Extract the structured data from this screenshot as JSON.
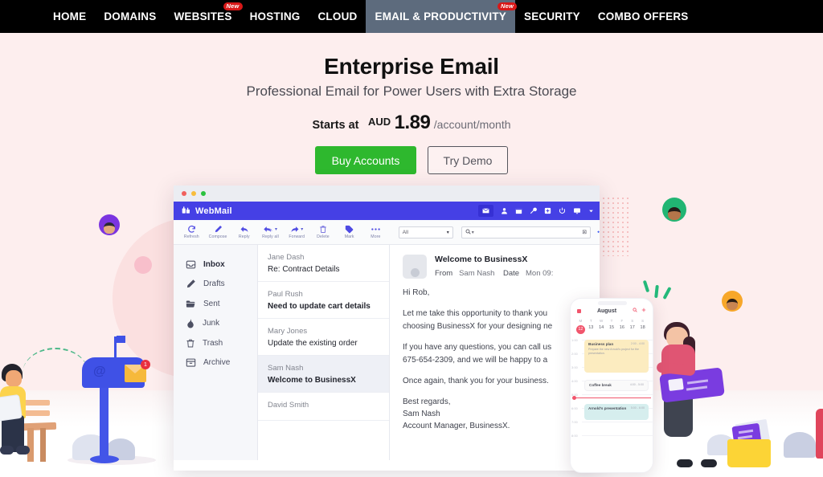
{
  "nav": {
    "items": [
      {
        "label": "HOME",
        "badge": null,
        "active": false
      },
      {
        "label": "DOMAINS",
        "badge": null,
        "active": false
      },
      {
        "label": "WEBSITES",
        "badge": "New",
        "active": false
      },
      {
        "label": "HOSTING",
        "badge": null,
        "active": false
      },
      {
        "label": "CLOUD",
        "badge": null,
        "active": false
      },
      {
        "label": "EMAIL & PRODUCTIVITY",
        "badge": "New",
        "active": true
      },
      {
        "label": "SECURITY",
        "badge": null,
        "active": false
      },
      {
        "label": "COMBO OFFERS",
        "badge": null,
        "active": false
      }
    ]
  },
  "hero": {
    "title": "Enterprise Email",
    "subtitle": "Professional Email for Power Users with Extra Storage",
    "price_prefix": "Starts at",
    "currency": "AUD",
    "amount": "1.89",
    "period": "/account/month",
    "buy_button": "Buy Accounts",
    "demo_button": "Try Demo"
  },
  "colors": {
    "page_bg": "#fdeeee",
    "nav_bg": "#000000",
    "nav_active_bg": "#5d6b7d",
    "badge_red": "#d81818",
    "buy_green": "#2eb82e",
    "webmail_purple": "#4540e5"
  },
  "webmail": {
    "brand": "WebMail",
    "window_dots": [
      "red",
      "yellow",
      "green"
    ],
    "top_icons": [
      "mail-icon",
      "user-icon",
      "calendar-icon",
      "wrench-icon",
      "plus-box-icon",
      "power-icon",
      "monitor-icon",
      "chevron-down-icon"
    ],
    "toolbar": [
      {
        "label": "Refresh",
        "icon": "refresh-icon",
        "caret": false
      },
      {
        "label": "Compose",
        "icon": "pencil-icon",
        "caret": false
      },
      {
        "label": "Reply",
        "icon": "reply-icon",
        "caret": false
      },
      {
        "label": "Reply all",
        "icon": "reply-all-icon",
        "caret": true
      },
      {
        "label": "Forward",
        "icon": "forward-icon",
        "caret": true
      },
      {
        "label": "Delete",
        "icon": "trash-icon",
        "caret": false
      },
      {
        "label": "Mark",
        "icon": "tag-icon",
        "caret": false
      },
      {
        "label": "More",
        "icon": "ellipsis-icon",
        "caret": false
      }
    ],
    "filter_value": "All",
    "search_placeholder": "Q",
    "sidebar": [
      {
        "label": "Inbox",
        "icon": "inbox-icon",
        "active": true
      },
      {
        "label": "Drafts",
        "icon": "pencil-icon",
        "active": false
      },
      {
        "label": "Sent",
        "icon": "folder-icon",
        "active": false
      },
      {
        "label": "Junk",
        "icon": "flame-icon",
        "active": false
      },
      {
        "label": "Trash",
        "icon": "trash-icon",
        "active": false
      },
      {
        "label": "Archive",
        "icon": "archive-icon",
        "active": false
      }
    ],
    "messages": [
      {
        "from": "Jane Dash",
        "subject": "Re: Contract Details",
        "selected": false
      },
      {
        "from": "Paul Rush",
        "subject": "Need to update cart details",
        "selected": false
      },
      {
        "from": "Mary Jones",
        "subject": "Update the existing order",
        "selected": false
      },
      {
        "from": "Sam Nash",
        "subject": "Welcome to BusinessX",
        "selected": true
      },
      {
        "from": "David Smith",
        "subject": "",
        "selected": false
      }
    ],
    "reading": {
      "subject": "Welcome to BusinessX",
      "from_label": "From",
      "from_value": "Sam Nash",
      "date_label": "Date",
      "date_value": "Mon 09:",
      "greeting": "Hi Rob,",
      "para1_line1": "Let me take this opportunity to thank you",
      "para1_line2": "choosing BusinessX for your designing ne",
      "para2_line1": "If you have any questions, you can call us",
      "para2_line2": "675-654-2309, and we will be happy to a",
      "para3": "Once again, thank you for your business.",
      "sign1": "Best regards,",
      "sign2": "Sam Nash",
      "sign3": "Account Manager, BusinessX."
    }
  },
  "phone": {
    "month": "August",
    "weekdays": [
      "M",
      "T",
      "W",
      "T",
      "F",
      "S",
      "S"
    ],
    "days": [
      "12",
      "13",
      "14",
      "15",
      "16",
      "17",
      "18"
    ],
    "today": "12",
    "hours": [
      "1:00",
      "2:00",
      "3:00",
      "4:00",
      "5:00",
      "6:00",
      "7:00",
      "8:00"
    ],
    "now_time": "4:45",
    "events": [
      {
        "title": "Business plan",
        "desc": "Prepare the new Arnold's project for the presentation.",
        "time": "2:00 - 4:00"
      },
      {
        "title": "Coffee break",
        "desc": "",
        "time": "4:00 - 5:00"
      },
      {
        "title": "Arnold's presentation",
        "desc": "",
        "time": "5:00 - 6:00"
      }
    ],
    "header_icons": [
      "search-icon",
      "plus-icon"
    ]
  },
  "illustration": {
    "left": {
      "person": "person-on-bench-with-laptop",
      "mailbox": "mailbox-with-envelope",
      "badge_count": "1",
      "at_symbol": "@"
    },
    "right": {
      "person": "woman-carrying-envelope",
      "tray": "file-tray-with-letter"
    },
    "avatars": [
      "avatar-purple",
      "avatar-green",
      "avatar-orange"
    ]
  }
}
